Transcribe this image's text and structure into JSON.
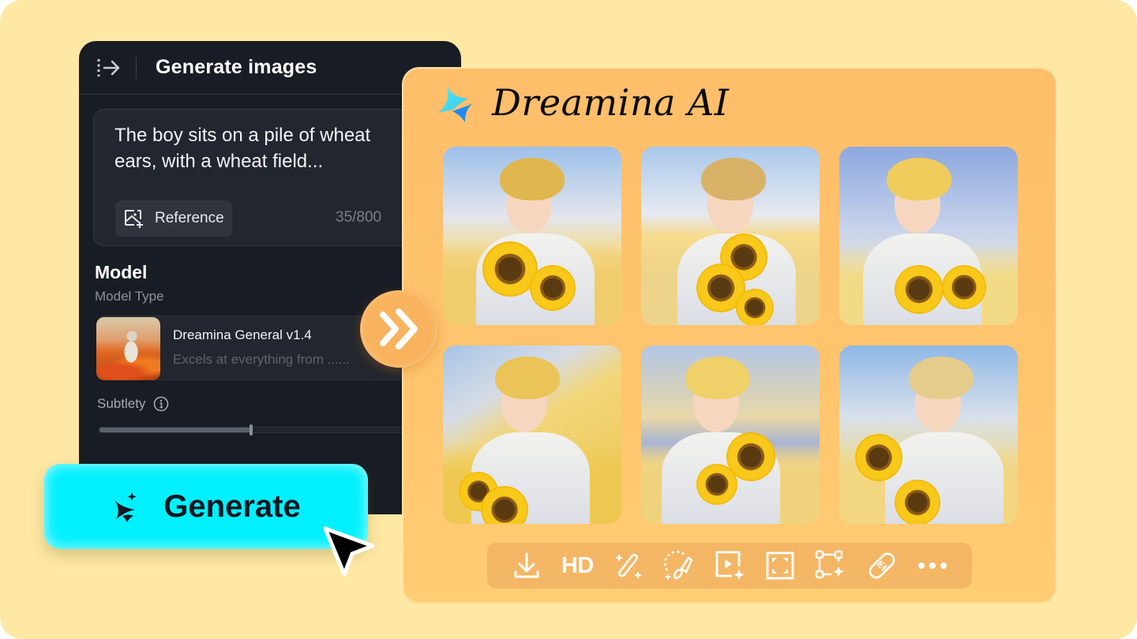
{
  "panel": {
    "title": "Generate images",
    "prompt": {
      "text": "The boy sits on a pile of wheat ears, with a wheat field...",
      "char_count": "35/800"
    },
    "reference_button": "Reference",
    "model_section": {
      "title": "Model",
      "subtitle": "Model Type",
      "selected_model": {
        "name": "Dreamina General v1.4",
        "description": "Excels at everything from ......"
      }
    },
    "subtlety": {
      "label": "Subtlety",
      "value_fraction": 0.46
    }
  },
  "generate_button": {
    "label": "Generate"
  },
  "result_card": {
    "brand_name": "Dreamina AI",
    "images": [
      {
        "alt": "boy with sunflowers in wheat field 1"
      },
      {
        "alt": "boy with sunflowers in wheat field 2"
      },
      {
        "alt": "boy with sunflowers in wheat field 3"
      },
      {
        "alt": "boy with sunflowers in wheat field 4"
      },
      {
        "alt": "boy with sunflowers in wheat field 5"
      },
      {
        "alt": "boy with sunflowers in wheat field 6"
      }
    ],
    "toolbar": {
      "hd_label": "HD",
      "tools": [
        "download",
        "HD upscale",
        "magic retouch",
        "inpaint",
        "animate",
        "expand",
        "edit elements",
        "remove",
        "more"
      ]
    }
  },
  "colors": {
    "background": "#FFE8A3",
    "panel": "#181C24",
    "accent_cyan": "#00F0FF",
    "card_orange": "#FFC36C"
  }
}
